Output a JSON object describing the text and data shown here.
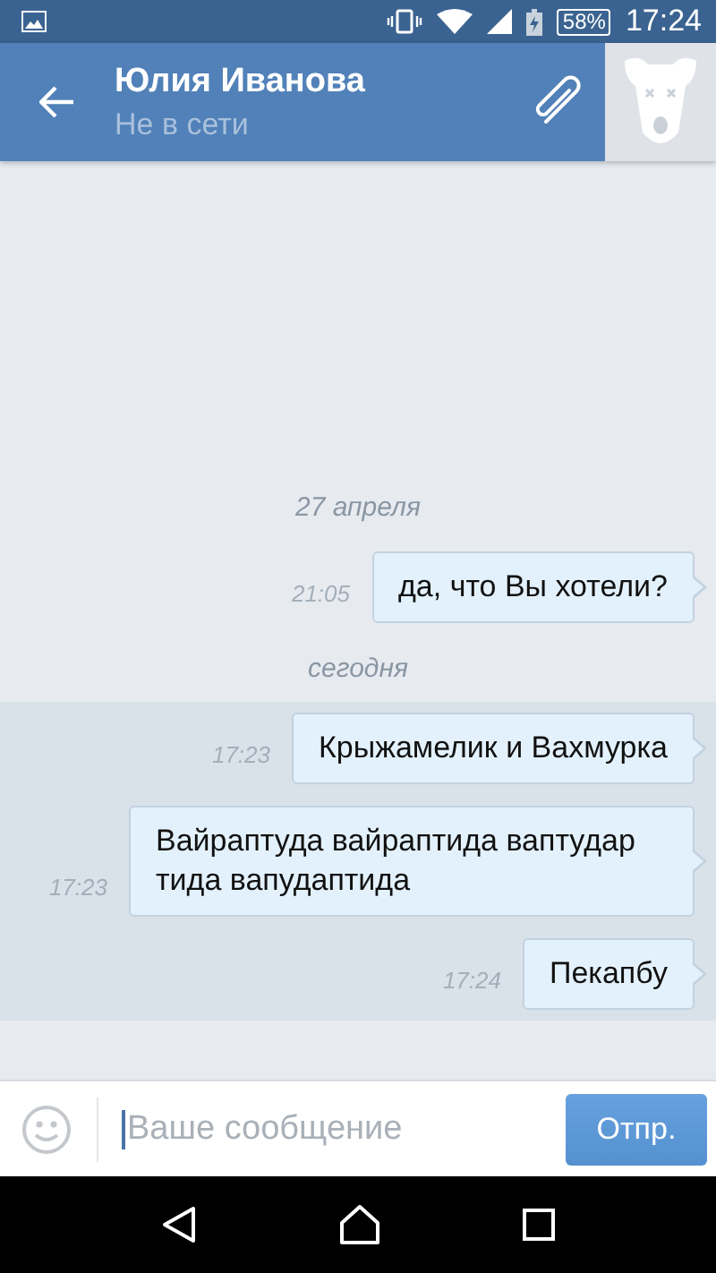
{
  "status_bar": {
    "battery": "58%",
    "time": "17:24"
  },
  "header": {
    "name": "Юлия Иванова",
    "status": "Не в сети"
  },
  "messages": [
    {
      "kind": "date",
      "text": "27 апреля"
    },
    {
      "kind": "message",
      "text": "да, что Вы хотели?",
      "time": "21:05",
      "unread": false
    },
    {
      "kind": "date",
      "text": "сегодня"
    },
    {
      "kind": "message",
      "text": "Крыжамелик и Вахмурка",
      "time": "17:23",
      "unread": true
    },
    {
      "kind": "message",
      "text": "Вайраптуда вайраптида ваптудар тида вапудаптида",
      "time": "17:23",
      "unread": true
    },
    {
      "kind": "message",
      "text": "Пекапбу",
      "time": "17:24",
      "unread": true
    }
  ],
  "composer": {
    "placeholder": "Ваше сообщение",
    "send": "Отпр."
  }
}
